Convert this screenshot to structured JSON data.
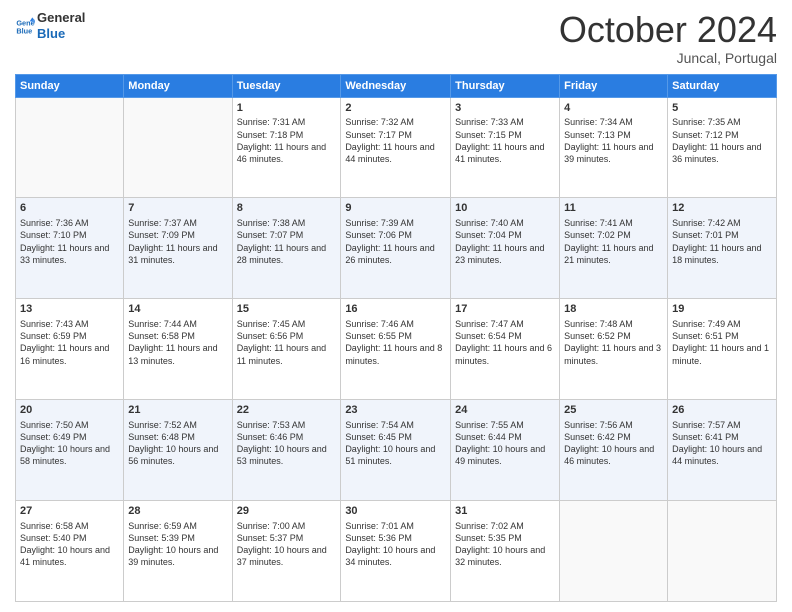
{
  "header": {
    "logo_line1": "General",
    "logo_line2": "Blue",
    "month": "October 2024",
    "location": "Juncal, Portugal"
  },
  "weekdays": [
    "Sunday",
    "Monday",
    "Tuesday",
    "Wednesday",
    "Thursday",
    "Friday",
    "Saturday"
  ],
  "weeks": [
    [
      {
        "day": "",
        "sunrise": "",
        "sunset": "",
        "daylight": ""
      },
      {
        "day": "",
        "sunrise": "",
        "sunset": "",
        "daylight": ""
      },
      {
        "day": "1",
        "sunrise": "Sunrise: 7:31 AM",
        "sunset": "Sunset: 7:18 PM",
        "daylight": "Daylight: 11 hours and 46 minutes."
      },
      {
        "day": "2",
        "sunrise": "Sunrise: 7:32 AM",
        "sunset": "Sunset: 7:17 PM",
        "daylight": "Daylight: 11 hours and 44 minutes."
      },
      {
        "day": "3",
        "sunrise": "Sunrise: 7:33 AM",
        "sunset": "Sunset: 7:15 PM",
        "daylight": "Daylight: 11 hours and 41 minutes."
      },
      {
        "day": "4",
        "sunrise": "Sunrise: 7:34 AM",
        "sunset": "Sunset: 7:13 PM",
        "daylight": "Daylight: 11 hours and 39 minutes."
      },
      {
        "day": "5",
        "sunrise": "Sunrise: 7:35 AM",
        "sunset": "Sunset: 7:12 PM",
        "daylight": "Daylight: 11 hours and 36 minutes."
      }
    ],
    [
      {
        "day": "6",
        "sunrise": "Sunrise: 7:36 AM",
        "sunset": "Sunset: 7:10 PM",
        "daylight": "Daylight: 11 hours and 33 minutes."
      },
      {
        "day": "7",
        "sunrise": "Sunrise: 7:37 AM",
        "sunset": "Sunset: 7:09 PM",
        "daylight": "Daylight: 11 hours and 31 minutes."
      },
      {
        "day": "8",
        "sunrise": "Sunrise: 7:38 AM",
        "sunset": "Sunset: 7:07 PM",
        "daylight": "Daylight: 11 hours and 28 minutes."
      },
      {
        "day": "9",
        "sunrise": "Sunrise: 7:39 AM",
        "sunset": "Sunset: 7:06 PM",
        "daylight": "Daylight: 11 hours and 26 minutes."
      },
      {
        "day": "10",
        "sunrise": "Sunrise: 7:40 AM",
        "sunset": "Sunset: 7:04 PM",
        "daylight": "Daylight: 11 hours and 23 minutes."
      },
      {
        "day": "11",
        "sunrise": "Sunrise: 7:41 AM",
        "sunset": "Sunset: 7:02 PM",
        "daylight": "Daylight: 11 hours and 21 minutes."
      },
      {
        "day": "12",
        "sunrise": "Sunrise: 7:42 AM",
        "sunset": "Sunset: 7:01 PM",
        "daylight": "Daylight: 11 hours and 18 minutes."
      }
    ],
    [
      {
        "day": "13",
        "sunrise": "Sunrise: 7:43 AM",
        "sunset": "Sunset: 6:59 PM",
        "daylight": "Daylight: 11 hours and 16 minutes."
      },
      {
        "day": "14",
        "sunrise": "Sunrise: 7:44 AM",
        "sunset": "Sunset: 6:58 PM",
        "daylight": "Daylight: 11 hours and 13 minutes."
      },
      {
        "day": "15",
        "sunrise": "Sunrise: 7:45 AM",
        "sunset": "Sunset: 6:56 PM",
        "daylight": "Daylight: 11 hours and 11 minutes."
      },
      {
        "day": "16",
        "sunrise": "Sunrise: 7:46 AM",
        "sunset": "Sunset: 6:55 PM",
        "daylight": "Daylight: 11 hours and 8 minutes."
      },
      {
        "day": "17",
        "sunrise": "Sunrise: 7:47 AM",
        "sunset": "Sunset: 6:54 PM",
        "daylight": "Daylight: 11 hours and 6 minutes."
      },
      {
        "day": "18",
        "sunrise": "Sunrise: 7:48 AM",
        "sunset": "Sunset: 6:52 PM",
        "daylight": "Daylight: 11 hours and 3 minutes."
      },
      {
        "day": "19",
        "sunrise": "Sunrise: 7:49 AM",
        "sunset": "Sunset: 6:51 PM",
        "daylight": "Daylight: 11 hours and 1 minute."
      }
    ],
    [
      {
        "day": "20",
        "sunrise": "Sunrise: 7:50 AM",
        "sunset": "Sunset: 6:49 PM",
        "daylight": "Daylight: 10 hours and 58 minutes."
      },
      {
        "day": "21",
        "sunrise": "Sunrise: 7:52 AM",
        "sunset": "Sunset: 6:48 PM",
        "daylight": "Daylight: 10 hours and 56 minutes."
      },
      {
        "day": "22",
        "sunrise": "Sunrise: 7:53 AM",
        "sunset": "Sunset: 6:46 PM",
        "daylight": "Daylight: 10 hours and 53 minutes."
      },
      {
        "day": "23",
        "sunrise": "Sunrise: 7:54 AM",
        "sunset": "Sunset: 6:45 PM",
        "daylight": "Daylight: 10 hours and 51 minutes."
      },
      {
        "day": "24",
        "sunrise": "Sunrise: 7:55 AM",
        "sunset": "Sunset: 6:44 PM",
        "daylight": "Daylight: 10 hours and 49 minutes."
      },
      {
        "day": "25",
        "sunrise": "Sunrise: 7:56 AM",
        "sunset": "Sunset: 6:42 PM",
        "daylight": "Daylight: 10 hours and 46 minutes."
      },
      {
        "day": "26",
        "sunrise": "Sunrise: 7:57 AM",
        "sunset": "Sunset: 6:41 PM",
        "daylight": "Daylight: 10 hours and 44 minutes."
      }
    ],
    [
      {
        "day": "27",
        "sunrise": "Sunrise: 6:58 AM",
        "sunset": "Sunset: 5:40 PM",
        "daylight": "Daylight: 10 hours and 41 minutes."
      },
      {
        "day": "28",
        "sunrise": "Sunrise: 6:59 AM",
        "sunset": "Sunset: 5:39 PM",
        "daylight": "Daylight: 10 hours and 39 minutes."
      },
      {
        "day": "29",
        "sunrise": "Sunrise: 7:00 AM",
        "sunset": "Sunset: 5:37 PM",
        "daylight": "Daylight: 10 hours and 37 minutes."
      },
      {
        "day": "30",
        "sunrise": "Sunrise: 7:01 AM",
        "sunset": "Sunset: 5:36 PM",
        "daylight": "Daylight: 10 hours and 34 minutes."
      },
      {
        "day": "31",
        "sunrise": "Sunrise: 7:02 AM",
        "sunset": "Sunset: 5:35 PM",
        "daylight": "Daylight: 10 hours and 32 minutes."
      },
      {
        "day": "",
        "sunrise": "",
        "sunset": "",
        "daylight": ""
      },
      {
        "day": "",
        "sunrise": "",
        "sunset": "",
        "daylight": ""
      }
    ]
  ]
}
